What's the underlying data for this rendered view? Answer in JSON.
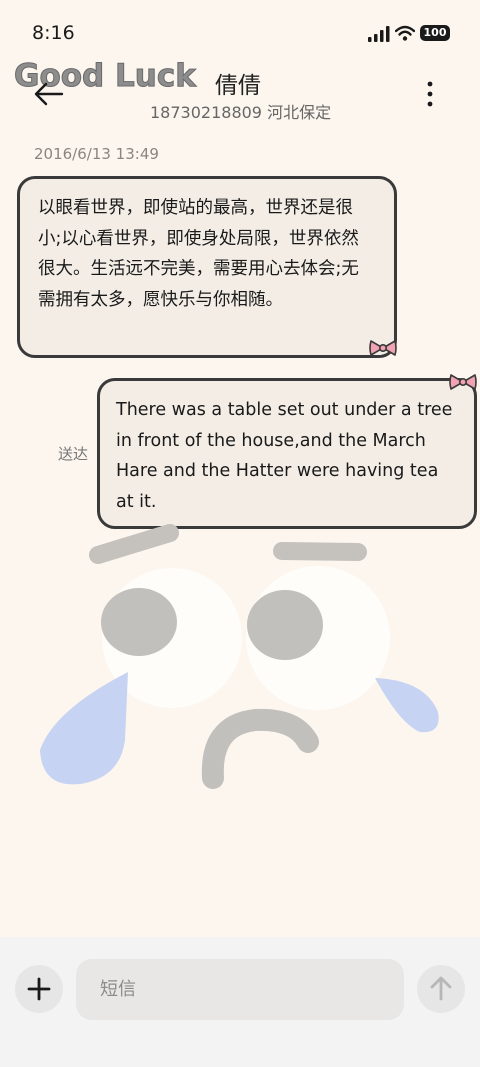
{
  "status_bar": {
    "time": "8:16",
    "battery": "100"
  },
  "header": {
    "decoration_text": "Good Luck",
    "contact_name": "倩倩",
    "contact_subtitle": "18730218809 河北保定",
    "back_icon": "arrow-left-icon",
    "more_icon": "more-vertical-icon"
  },
  "thread": {
    "date": "2016/6/13 13:49",
    "messages": [
      {
        "direction": "incoming",
        "text": "以眼看世界，即使站的最高，世界还是很小;以心看世界，即使身处局限，世界依然很大。生活远不完美，需要用心去体会;无需拥有太多，愿快乐与你相随。"
      },
      {
        "direction": "outgoing",
        "text": "There was a table set out under a tree in front of the house,and the March Hare and the Hatter were having tea at it.",
        "status": "送达"
      }
    ]
  },
  "composer": {
    "placeholder": "短信",
    "add_icon": "plus-icon",
    "send_icon": "arrow-up-icon"
  },
  "colors": {
    "background": "#fcf6ef",
    "bubble_fill": "#f3ede6",
    "bubble_border": "#3a3a3a",
    "bow_pink": "#f2a3b3",
    "tear_blue": "#c7d3f2"
  }
}
